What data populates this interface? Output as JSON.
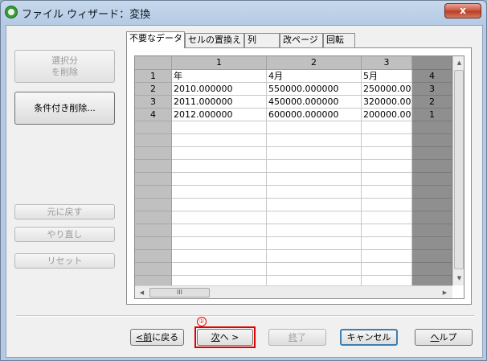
{
  "window": {
    "title": "ファイル ウィザード：変換",
    "close_symbol": "x"
  },
  "sidebar": {
    "delete_selection": "選択分\nを削除",
    "conditional_delete": "条件付き削除...",
    "undo": "元に戻す",
    "redo": "やり直し",
    "reset": "リセット"
  },
  "tabs": [
    {
      "label": "不要なデータ",
      "active": true
    },
    {
      "label": "セルの置換え",
      "active": false
    },
    {
      "label": "列",
      "active": false
    },
    {
      "label": "改ページ",
      "active": false
    },
    {
      "label": "回転",
      "active": false
    }
  ],
  "grid": {
    "column_headers": [
      "1",
      "2",
      "3"
    ],
    "rows": [
      {
        "num": "1",
        "cells": [
          "年",
          "4月",
          "5月"
        ],
        "ghost": "4"
      },
      {
        "num": "2",
        "cells": [
          "2010.000000",
          "550000.000000",
          "250000.000"
        ],
        "ghost": "3"
      },
      {
        "num": "3",
        "cells": [
          "2011.000000",
          "450000.000000",
          "320000.000"
        ],
        "ghost": "2"
      },
      {
        "num": "4",
        "cells": [
          "2012.000000",
          "600000.000000",
          "200000.000"
        ],
        "ghost": "1"
      }
    ],
    "empty_rows": 13,
    "h_thumb_label": "III"
  },
  "footer": {
    "back_prefix": "<",
    "back_hotkey": "前",
    "back_rest": "に戻る",
    "next_hotkey": "次",
    "next_rest": "へ >",
    "finish_hotkey": "終",
    "finish_rest": "了",
    "cancel": "キャンセル",
    "help_hotkey": "ヘ",
    "help_rest": "ルプ"
  },
  "annotation": {
    "step_marker": "①"
  }
}
